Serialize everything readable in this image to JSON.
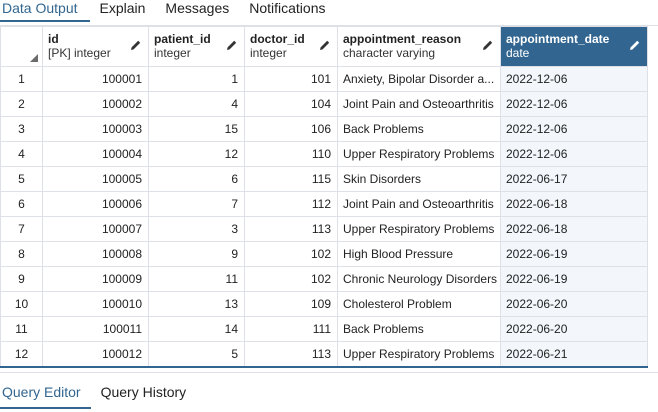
{
  "top_tabs": [
    {
      "label": "Data Output",
      "active": true
    },
    {
      "label": "Explain",
      "active": false
    },
    {
      "label": "Messages",
      "active": false
    },
    {
      "label": "Notifications",
      "active": false
    }
  ],
  "columns": [
    {
      "name": "id",
      "type": "[PK] integer",
      "editable": true,
      "selected": false
    },
    {
      "name": "patient_id",
      "type": "integer",
      "editable": true,
      "selected": false
    },
    {
      "name": "doctor_id",
      "type": "integer",
      "editable": true,
      "selected": false
    },
    {
      "name": "appointment_reason",
      "type": "character varying",
      "editable": true,
      "selected": false
    },
    {
      "name": "appointment_date",
      "type": "date",
      "editable": true,
      "selected": true
    }
  ],
  "rows": [
    {
      "n": "1",
      "id": "100001",
      "patient_id": "1",
      "doctor_id": "101",
      "reason": "Anxiety, Bipolar Disorder a...",
      "date": "2022-12-06"
    },
    {
      "n": "2",
      "id": "100002",
      "patient_id": "4",
      "doctor_id": "104",
      "reason": "Joint Pain and Osteoarthritis",
      "date": "2022-12-06"
    },
    {
      "n": "3",
      "id": "100003",
      "patient_id": "15",
      "doctor_id": "106",
      "reason": "Back Problems",
      "date": "2022-12-06"
    },
    {
      "n": "4",
      "id": "100004",
      "patient_id": "12",
      "doctor_id": "110",
      "reason": "Upper Respiratory Problems",
      "date": "2022-12-06"
    },
    {
      "n": "5",
      "id": "100005",
      "patient_id": "6",
      "doctor_id": "115",
      "reason": "Skin Disorders",
      "date": "2022-06-17"
    },
    {
      "n": "6",
      "id": "100006",
      "patient_id": "7",
      "doctor_id": "112",
      "reason": "Joint Pain and Osteoarthritis",
      "date": "2022-06-18"
    },
    {
      "n": "7",
      "id": "100007",
      "patient_id": "3",
      "doctor_id": "113",
      "reason": "Upper Respiratory Problems",
      "date": "2022-06-18"
    },
    {
      "n": "8",
      "id": "100008",
      "patient_id": "9",
      "doctor_id": "102",
      "reason": "High Blood Pressure",
      "date": "2022-06-19"
    },
    {
      "n": "9",
      "id": "100009",
      "patient_id": "11",
      "doctor_id": "102",
      "reason": "Chronic Neurology Disorders",
      "date": "2022-06-19"
    },
    {
      "n": "10",
      "id": "100010",
      "patient_id": "13",
      "doctor_id": "109",
      "reason": "Cholesterol Problem",
      "date": "2022-06-20"
    },
    {
      "n": "11",
      "id": "100011",
      "patient_id": "14",
      "doctor_id": "111",
      "reason": "Back Problems",
      "date": "2022-06-20"
    },
    {
      "n": "12",
      "id": "100012",
      "patient_id": "5",
      "doctor_id": "113",
      "reason": "Upper Respiratory Problems",
      "date": "2022-06-21"
    }
  ],
  "bottom_tabs": [
    {
      "label": "Query Editor",
      "active": true
    },
    {
      "label": "Query History",
      "active": false
    }
  ],
  "icons": {
    "column_edit": "pencil-icon",
    "select_all": "corner-triangle-icon"
  },
  "colors": {
    "accent": "#326690",
    "grid_line": "#dde0e6",
    "selected_column_bg": "#f3f7fb"
  }
}
